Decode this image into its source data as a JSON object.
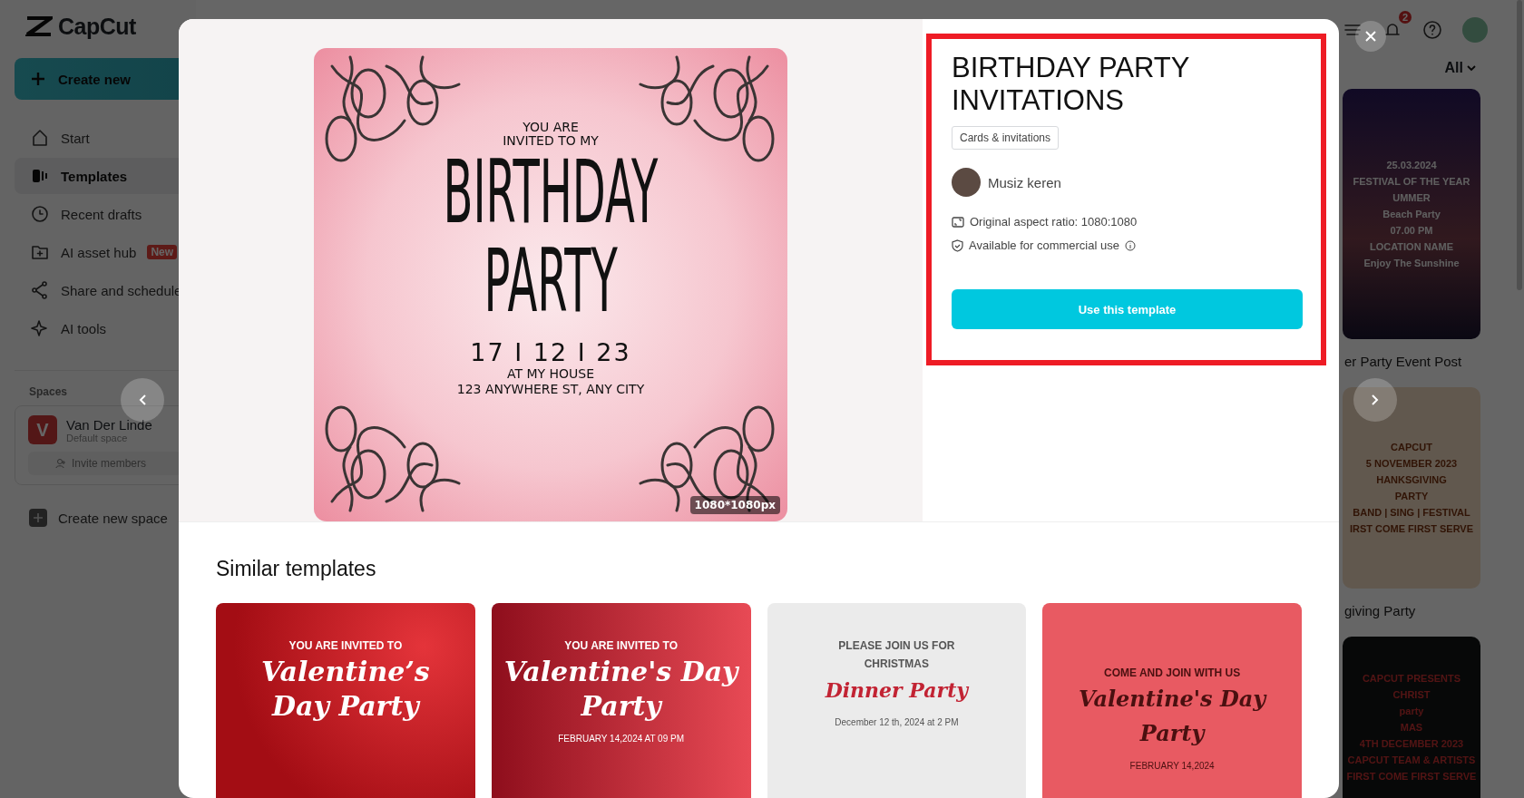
{
  "sidebar": {
    "logo": "CapCut",
    "create_button": "Create new",
    "nav": [
      {
        "label": "Start",
        "selected": false
      },
      {
        "label": "Templates",
        "selected": true
      },
      {
        "label": "Recent drafts",
        "selected": false
      },
      {
        "label": "AI asset hub",
        "selected": false,
        "badge": "New"
      },
      {
        "label": "Share and schedule",
        "selected": false
      },
      {
        "label": "AI tools",
        "selected": false
      }
    ],
    "spaces_heading": "Spaces",
    "space": {
      "initial": "V",
      "name": "Van Der Linde",
      "subtitle": "Default space",
      "invite": "Invite members"
    },
    "create_space": "Create new space"
  },
  "header": {
    "notification_count": "2"
  },
  "filter": {
    "label": "All"
  },
  "background_templates": [
    {
      "lines": [
        "25.03.2024",
        "FESTIVAL OF THE YEAR",
        "UMMER",
        "Beach Party",
        "07.00 PM",
        "LOCATION NAME",
        "Enjoy The Sunshine"
      ],
      "title": "er Party Event Post",
      "kind": "night"
    },
    {
      "lines": [
        "CAPCUT",
        "5 NOVEMBER 2023",
        "HANKSGIVING",
        "PARTY",
        "BAND | SING | FESTIVAL",
        "IRST COME FIRST SERVE"
      ],
      "title": "giving Party",
      "kind": "autumn"
    },
    {
      "lines": [
        "CAPCUT PRESENTS",
        "CHRIST",
        "party",
        "MAS",
        "4TH DECEMBER 2023",
        "CAPCUT TEAM & ARTISTS",
        "FIRST COME FIRST SERVE"
      ],
      "kind": "dark"
    }
  ],
  "modal": {
    "preview": {
      "lines": [
        "YOU ARE",
        "INVITED TO MY"
      ],
      "headline": [
        "BIRTHDAY",
        "PARTY"
      ],
      "date": "17 I 12 I 23",
      "place": [
        "AT MY HOUSE",
        "123 ANYWHERE ST, ANY CITY"
      ],
      "size": "1080*1080px"
    },
    "info": {
      "highlighted": true,
      "title": "BIRTHDAY PARTY INVITATIONS",
      "tag": "Cards & invitations",
      "author": "Musiz keren",
      "aspect": "Original aspect ratio: 1080:1080",
      "license": "Available for commercial use",
      "button": "Use this template"
    },
    "similar_heading": "Similar templates",
    "similar": [
      {
        "kind": "roses",
        "lines": [
          "YOU ARE INVITED TO"
        ],
        "script": [
          "Valentine’s",
          "Day Party"
        ]
      },
      {
        "kind": "sparkle",
        "lines": [
          "YOU ARE INVITED TO"
        ],
        "script": [
          "Valentine's Day",
          "Party"
        ],
        "footer": "FEBRUARY 14,2024 AT 09 PM"
      },
      {
        "kind": "wreath",
        "lines": [
          "PLEASE JOIN US FOR",
          "CHRISTMAS"
        ],
        "script": [
          "Dinner Party"
        ],
        "footer": "December 12 th, 2024 at 2 PM"
      },
      {
        "kind": "hearts",
        "lines": [
          "COME AND JOIN WITH US"
        ],
        "script": [
          "Valentine's Day",
          "Party"
        ],
        "footer": "FEBRUARY 14,2024"
      }
    ]
  }
}
